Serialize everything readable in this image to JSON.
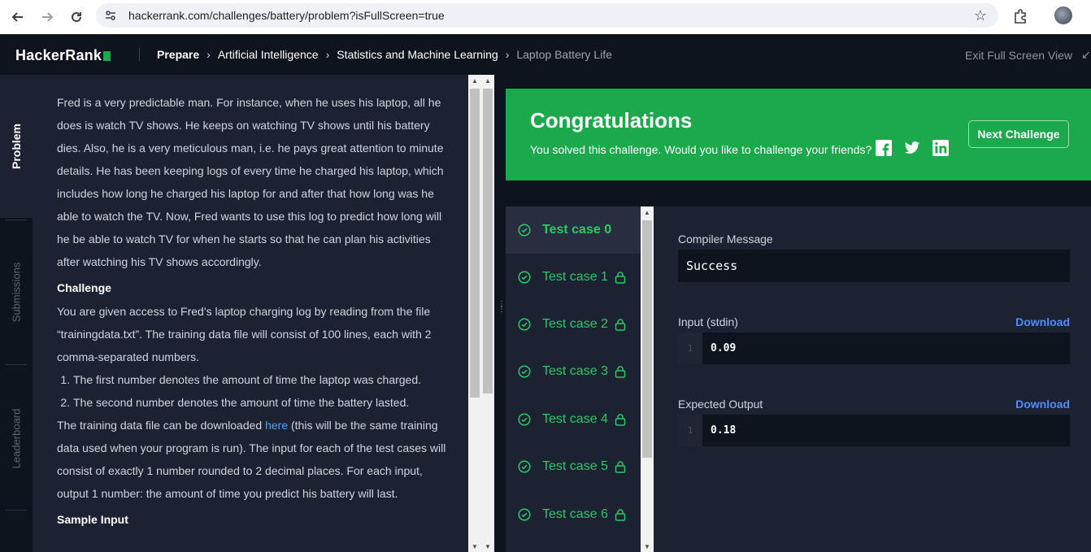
{
  "browser": {
    "url": "hackerrank.com/challenges/battery/problem?isFullScreen=true"
  },
  "header": {
    "logo": "HackerRank",
    "breadcrumbs": [
      "Prepare",
      "Artificial Intelligence",
      "Statistics and Machine Learning",
      "Laptop Battery Life"
    ],
    "exit_fullscreen": "Exit Full Screen View"
  },
  "sidebar": {
    "tabs": [
      "Problem",
      "Submissions",
      "Leaderboard"
    ]
  },
  "problem": {
    "intro": "Fred is a very predictable man. For instance, when he uses his laptop, all he does is watch TV shows. He keeps on watching TV shows until his battery dies. Also, he is a very meticulous man, i.e. he pays great attention to minute details. He has been keeping logs of every time he charged his laptop, which includes how long he charged his laptop for and after that how long was he able to watch the TV. Now, Fred wants to use this log to predict how long will he be able to watch TV for when he starts so that he can plan his activities after watching his TV shows accordingly.",
    "challenge_heading": "Challenge",
    "challenge_text": "You are given access to Fred’s laptop charging log by reading from the file “trainingdata.txt”. The training data file will consist of 100 lines, each with 2 comma-separated numbers.",
    "list": [
      "The first number denotes the amount of time the laptop was charged.",
      "The second number denotes the amount of time the battery lasted."
    ],
    "download_text_before": "The training data file can be downloaded ",
    "download_link": "here",
    "download_text_after": " (this will be the same training data used when your program is run). The input for each of the test cases will consist of exactly 1 number rounded to 2 decimal places. For each input, output 1 number: the amount of time you predict his battery will last.",
    "sample_input_heading": "Sample Input"
  },
  "congrats": {
    "title": "Congratulations",
    "subtitle": "You solved this challenge. Would you like to challenge your friends?",
    "next_button": "Next Challenge",
    "share_icons": [
      "facebook-icon",
      "twitter-icon",
      "linkedin-icon"
    ]
  },
  "test_cases": [
    {
      "label": "Test case 0",
      "locked": false
    },
    {
      "label": "Test case 1",
      "locked": true
    },
    {
      "label": "Test case 2",
      "locked": true
    },
    {
      "label": "Test case 3",
      "locked": true
    },
    {
      "label": "Test case 4",
      "locked": true
    },
    {
      "label": "Test case 5",
      "locked": true
    },
    {
      "label": "Test case 6",
      "locked": true
    }
  ],
  "output": {
    "compiler_label": "Compiler Message",
    "compiler_message": "Success",
    "input_label": "Input (stdin)",
    "input_download": "Download",
    "input_line_no": "1",
    "input_value": "0.09",
    "expected_label": "Expected Output",
    "expected_download": "Download",
    "expected_line_no": "1",
    "expected_value": "0.18"
  },
  "colors": {
    "success_green": "#1ba94c",
    "testcase_green": "#2ec866",
    "link_blue": "#4f8cff",
    "panel_bg": "#1b2232",
    "page_bg": "#0e141e"
  }
}
